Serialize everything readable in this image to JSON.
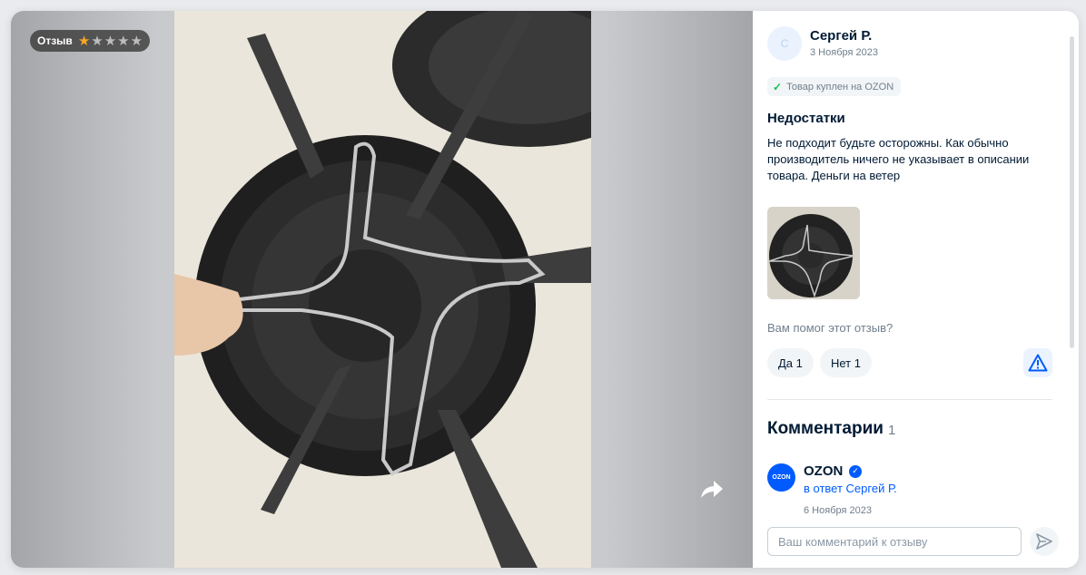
{
  "review": {
    "badge_label": "Отзыв",
    "rating": 1,
    "rating_max": 5,
    "author_initial": "С",
    "author": "Сергей Р.",
    "date": "3 Ноября 2023",
    "purchase_label": "Товар куплен на OZON",
    "section_title": "Недостатки",
    "section_text": "Не подходит будьте осторожны. Как обычно производитель ничего не указывает в описании товара. Деньги на ветер"
  },
  "helpful": {
    "question": "Вам помог этот отзыв?",
    "yes_label": "Да 1",
    "no_label": "Нет 1"
  },
  "comments": {
    "title": "Комментарии",
    "count": "1",
    "items": [
      {
        "logo_text": "OZON",
        "author": "OZON",
        "reply_to": "в ответ Сергей Р.",
        "date": "6 Ноября 2023"
      }
    ],
    "input_placeholder": "Ваш комментарий к отзыву"
  },
  "colors": {
    "accent": "#005bff",
    "star_on": "#f9a825",
    "star_off": "#bdbdbd",
    "check": "#10c44c",
    "text": "#001a34",
    "muted": "#707f8d"
  },
  "icons": [
    "star-icon",
    "share-icon",
    "check-icon",
    "report-icon",
    "verified-icon",
    "send-icon"
  ]
}
